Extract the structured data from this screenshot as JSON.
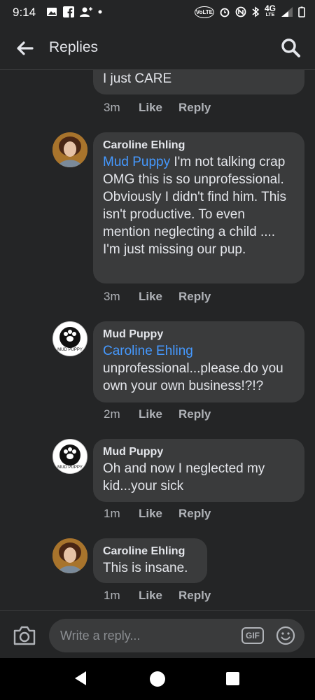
{
  "status_bar": {
    "time": "9:14",
    "network": "4G",
    "network_sub": "LTE",
    "volte": "VoLTE"
  },
  "header": {
    "title": "Replies"
  },
  "comments": [
    {
      "author": "",
      "text": "I just CARE",
      "time": "3m",
      "like": "Like",
      "reply": "Reply"
    },
    {
      "author": "Caroline Ehling",
      "mention": "Mud Puppy",
      "text": " I'm not talking crap OMG this is so unprofessional. Obviously I didn't find him. This isn't productive.  To even mention neglecting a child .... I'm just missing our pup.",
      "time": "3m",
      "like": "Like",
      "reply": "Reply"
    },
    {
      "author": "Mud Puppy",
      "mention": "Caroline Ehling",
      "text": "unprofessional...please.do you own your own business!?!?",
      "time": "2m",
      "like": "Like",
      "reply": "Reply"
    },
    {
      "author": "Mud Puppy",
      "text": "Oh and now I neglected my kid...your sick",
      "time": "1m",
      "like": "Like",
      "reply": "Reply"
    },
    {
      "author": "Caroline Ehling",
      "text": "This is insane.",
      "time": "1m",
      "like": "Like",
      "reply": "Reply"
    }
  ],
  "avatar_text": "MUD PUPPY",
  "composer": {
    "placeholder": "Write a reply...",
    "gif_label": "GIF"
  },
  "colors": {
    "background": "#242526",
    "bubble": "#3a3b3c",
    "mention": "#4599ff",
    "meta": "#b0b3b8"
  }
}
